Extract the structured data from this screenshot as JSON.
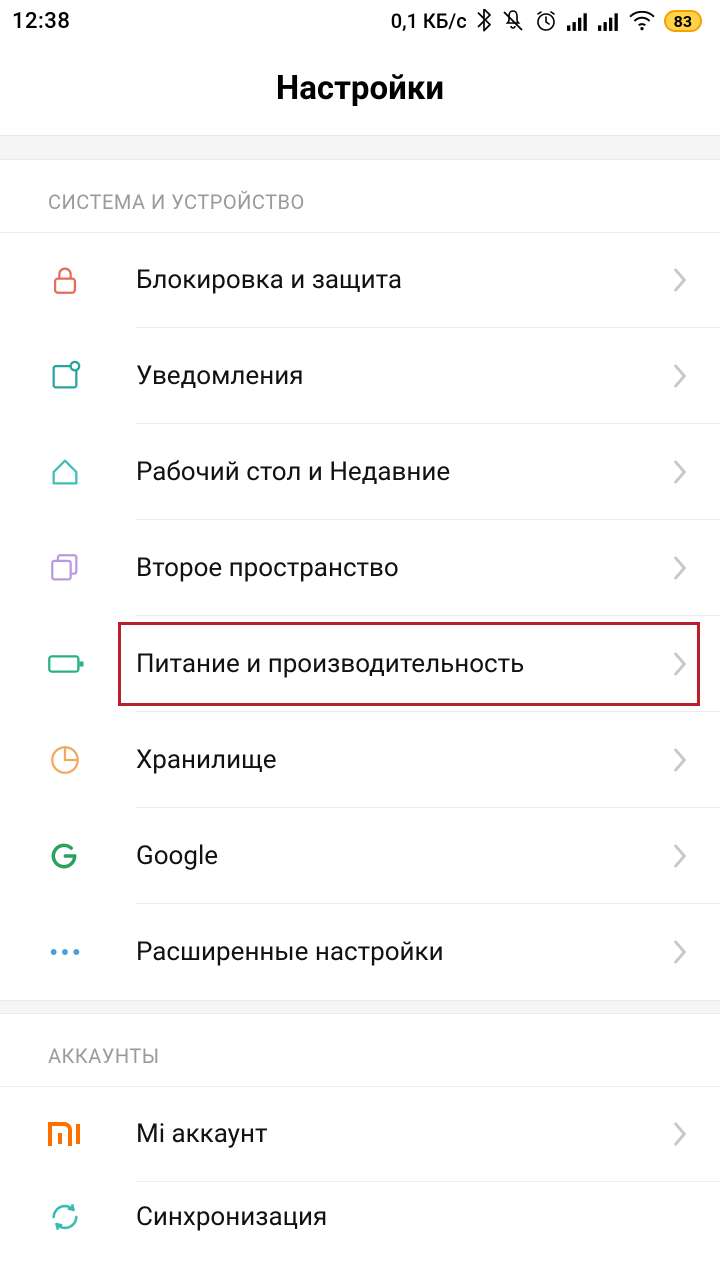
{
  "status": {
    "time": "12:38",
    "data_rate": "0,1 КБ/с",
    "battery": "83"
  },
  "header": {
    "title": "Настройки"
  },
  "sections": {
    "system": {
      "title": "СИСТЕМА И УСТРОЙСТВО",
      "items": [
        {
          "label": "Блокировка и защита"
        },
        {
          "label": "Уведомления"
        },
        {
          "label": "Рабочий стол и Недавние"
        },
        {
          "label": "Второе пространство"
        },
        {
          "label": "Питание и производительность"
        },
        {
          "label": "Хранилище"
        },
        {
          "label": "Google"
        },
        {
          "label": "Расширенные настройки"
        }
      ]
    },
    "accounts": {
      "title": "АККАУНТЫ",
      "items": [
        {
          "label": "Mi аккаунт"
        },
        {
          "label": "Синхронизация"
        }
      ]
    }
  }
}
